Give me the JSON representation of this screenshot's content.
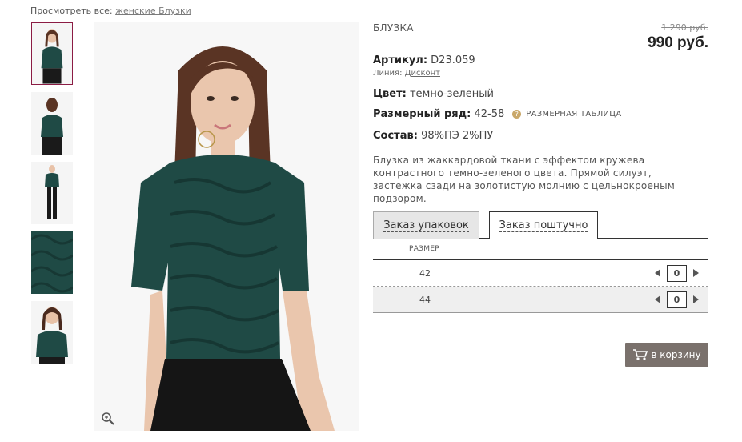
{
  "breadcrumb": {
    "view_all_prefix": "Просмотреть все:",
    "view_all_link": "женские Блузки"
  },
  "product": {
    "name": "БЛУЗКА",
    "old_price": "1 290 руб.",
    "price": "990 руб.",
    "article_label": "Артикул:",
    "article_value": "D23.059",
    "line_label": "Линия:",
    "line_value": "Дисконт",
    "color_label": "Цвет:",
    "color_value": "темно-зеленый",
    "size_range_label": "Размерный ряд:",
    "size_range_value": "42-58",
    "size_table_link": "РАЗМЕРНАЯ ТАБЛИЦА",
    "composition_label": "Состав:",
    "composition_value": "98%ПЭ 2%ПУ",
    "description": "Блузка из жаккардовой ткани с эффектом кружева контрастного темно-зеленого цвета. Прямой силуэт, застежка сзади на золотистую молнию с цельнокроеным подзором."
  },
  "tabs": [
    {
      "label": "Заказ упаковок",
      "active": false
    },
    {
      "label": "Заказ поштучно",
      "active": true
    }
  ],
  "size_table": {
    "header": "РАЗМЕР",
    "rows": [
      {
        "size": "42",
        "qty": "0"
      },
      {
        "size": "44",
        "qty": "0"
      }
    ]
  },
  "cart_button": {
    "label": "в корзину"
  },
  "colors": {
    "accent_border": "#8b1c44",
    "blouse": "#1f4a45",
    "cart_button": "#7a716c"
  },
  "icons": {
    "zoom": "zoom-icon",
    "cart": "cart-icon",
    "help": "question-icon"
  }
}
